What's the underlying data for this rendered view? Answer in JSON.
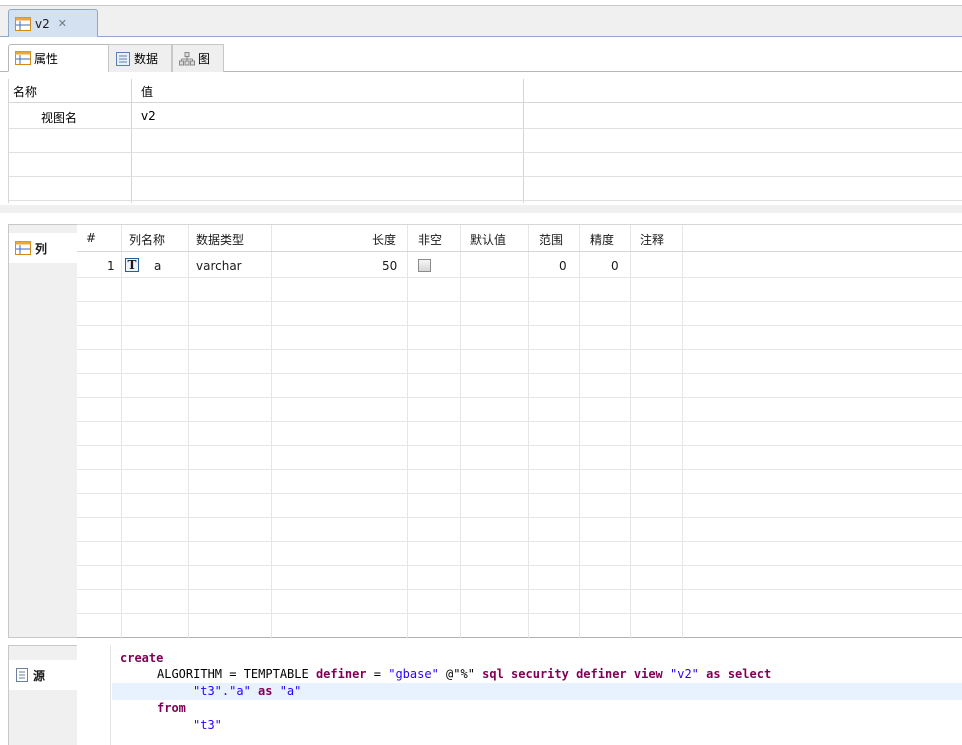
{
  "editor_tab": {
    "title": "v2",
    "icon": "view-table-icon",
    "close_glyph": "✕"
  },
  "inner_tabs": [
    {
      "label": "属性",
      "icon": "properties-icon"
    },
    {
      "label": "数据",
      "icon": "data-icon"
    },
    {
      "label": "图",
      "icon": "diagram-icon"
    }
  ],
  "properties": {
    "headers": {
      "name": "名称",
      "value": "值"
    },
    "rows": [
      {
        "name": "视图名",
        "value": "v2"
      }
    ]
  },
  "side_tabs": {
    "columns": "列",
    "source": "源"
  },
  "columns_table": {
    "headers": [
      "#",
      "列名称",
      "数据类型",
      "长度",
      "非空",
      "默认值",
      "范围",
      "精度",
      "注释"
    ],
    "rows": [
      {
        "index": "1",
        "type_icon": "T",
        "name": "a",
        "data_type": "varchar",
        "length": "50",
        "not_null": false,
        "default": "",
        "scale": "0",
        "precision": "0",
        "comment": ""
      }
    ]
  },
  "source": {
    "line1": "create",
    "line2_a": "ALGORITHM = TEMPTABLE",
    "line2_b": "definer",
    "line2_c": " = ",
    "line2_d": "\"gbase\"",
    "line2_e": " @\"%\" ",
    "line2_f": "sql security definer view",
    "line2_g": " \"v2\" ",
    "line2_h": "as select",
    "line3_a": "\"t3\".\"a\"",
    "line3_b": " as ",
    "line3_c": "\"a\"",
    "line4": "from",
    "line5": "\"t3\""
  },
  "colors": {
    "tab_active": "#d3e1f1",
    "highlight_line": "#e8f2fe",
    "keyword": "#7f0055",
    "string": "#2a00ff"
  }
}
